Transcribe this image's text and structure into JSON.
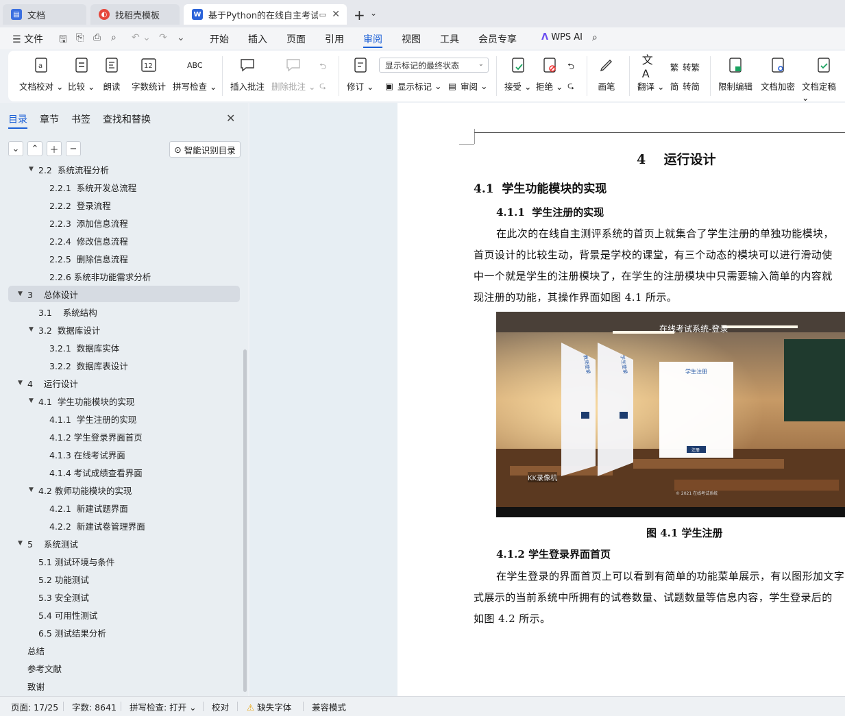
{
  "tabs": {
    "doc": "文档",
    "template": "找稻壳模板",
    "active": "基于Python的在线自主考试系"
  },
  "menu": {
    "file": "文件",
    "items": [
      "开始",
      "插入",
      "页面",
      "引用",
      "审阅",
      "视图",
      "工具",
      "会员专享"
    ],
    "wps_ai": "WPS AI"
  },
  "ribbon": {
    "proofread": "文档校对",
    "compare": "比较",
    "read_aloud": "朗读",
    "word_count": "字数统计",
    "spell_check": "拼写检查",
    "insert_comment": "插入批注",
    "delete_comment": "删除批注",
    "revise": "修订",
    "markup_status": "显示标记的最终状态",
    "show_markup": "显示标记",
    "review": "审阅",
    "accept": "接受",
    "reject": "拒绝",
    "pen": "画笔",
    "translate": "翻译",
    "to_traditional": "转繁",
    "to_simplified": "转简",
    "restrict_edit": "限制编辑",
    "encrypt": "文档加密",
    "finalize": "文档定稿"
  },
  "nav": {
    "tabs": [
      "目录",
      "章节",
      "书签",
      "查找和替换"
    ],
    "ai_toc": "智能识别目录",
    "toc": [
      {
        "label": "2.2  系统流程分析",
        "level": 2,
        "arrow": true
      },
      {
        "label": "2.2.1  系统开发总流程",
        "level": 3
      },
      {
        "label": "2.2.2  登录流程",
        "level": 3
      },
      {
        "label": "2.2.3  添加信息流程",
        "level": 3
      },
      {
        "label": "2.2.4  修改信息流程",
        "level": 3
      },
      {
        "label": "2.2.5  删除信息流程",
        "level": 3
      },
      {
        "label": "2.2.6 系统非功能需求分析",
        "level": 3
      },
      {
        "label": "3    总体设计",
        "level": 1,
        "arrow": true,
        "selected": true
      },
      {
        "label": "3.1    系统结构",
        "level": 2
      },
      {
        "label": "3.2  数据库设计",
        "level": 2,
        "arrow": true
      },
      {
        "label": "3.2.1  数据库实体",
        "level": 3
      },
      {
        "label": "3.2.2  数据库表设计",
        "level": 3
      },
      {
        "label": "4    运行设计",
        "level": 1,
        "arrow": true
      },
      {
        "label": "4.1  学生功能模块的实现",
        "level": 2,
        "arrow": true
      },
      {
        "label": "4.1.1  学生注册的实现",
        "level": 3
      },
      {
        "label": "4.1.2 学生登录界面首页",
        "level": 3
      },
      {
        "label": "4.1.3 在线考试界面",
        "level": 3
      },
      {
        "label": "4.1.4 考试成绩查看界面",
        "level": 3
      },
      {
        "label": "4.2 教师功能模块的实现",
        "level": 2,
        "arrow": true
      },
      {
        "label": "4.2.1  新建试题界面",
        "level": 3
      },
      {
        "label": "4.2.2  新建试卷管理界面",
        "level": 3
      },
      {
        "label": "5    系统测试",
        "level": 1,
        "arrow": true
      },
      {
        "label": "5.1 测试环境与条件",
        "level": 2
      },
      {
        "label": "5.2 功能测试",
        "level": 2
      },
      {
        "label": "5.3 安全测试",
        "level": 2
      },
      {
        "label": "5.4 可用性测试",
        "level": 2
      },
      {
        "label": "6.5 测试结果分析",
        "level": 2
      },
      {
        "label": "总结",
        "level": 1
      },
      {
        "label": "参考文献",
        "level": 1
      },
      {
        "label": "致谢",
        "level": 1
      }
    ]
  },
  "document": {
    "chapter_title": "4    运行设计",
    "section_41": "4.1  学生功能模块的实现",
    "section_411": "4.1.1  学生注册的实现",
    "para1": [
      "在此次的在线自主测评系统的首页上就集合了学生注册的单独功能模块，",
      "首页设计的比较生动，背景是学校的课堂，有三个动态的模块可以进行滑动使",
      "中一个就是学生的注册模块了，在学生的注册模块中只需要输入简单的内容就",
      "现注册的功能，其操作界面如图 4.1 所示。"
    ],
    "figure": {
      "banner": "在线考试系统-登录",
      "panel_title": "学生注册",
      "card1": "教师登录",
      "card2": "学生登录",
      "submit": "注册",
      "watermark": "KK录像机",
      "footer": "© 2021 在线考试系统"
    },
    "figure_caption": "图 4.1 学生注册",
    "section_412": "4.1.2 学生登录界面首页",
    "para2": [
      "在学生登录的界面首页上可以看到有简单的功能菜单展示，有以图形加文字",
      "式展示的当前系统中所拥有的试卷数量、试题数量等信息内容，学生登录后的",
      "如图 4.2 所示。"
    ]
  },
  "status": {
    "page": "页面: 17/25",
    "words": "字数: 8641",
    "spell": "拼写检查: 打开",
    "proof": "校对",
    "missing_font": "缺失字体",
    "compat": "兼容模式"
  }
}
